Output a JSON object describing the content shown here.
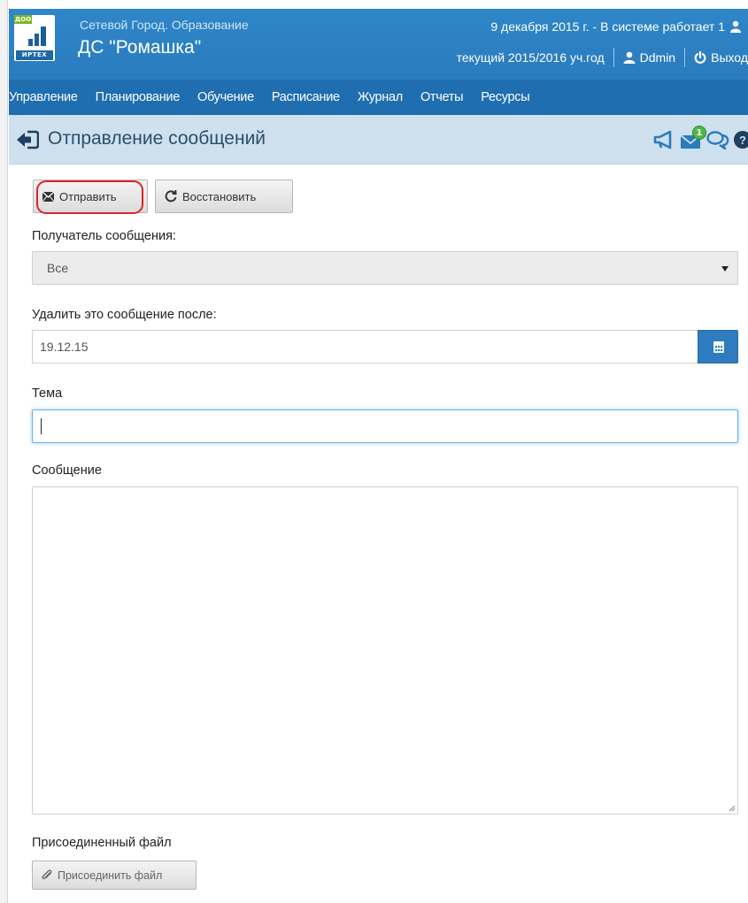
{
  "header": {
    "logo_tag": "ДОО",
    "logo_brand": "ИРТЕХ",
    "system_name": "Сетевой Город. Образование",
    "org_name": "ДС \"Ромашка\"",
    "status_text": "9 декабря 2015 г. - В системе работает 1",
    "year_text": "текущий 2015/2016 уч.год",
    "user_name": "Ddmin",
    "logout_label": "Выход"
  },
  "menu": {
    "items": [
      "Управление",
      "Планирование",
      "Обучение",
      "Расписание",
      "Журнал",
      "Отчеты",
      "Ресурсы"
    ]
  },
  "titlebar": {
    "title": "Отправление сообщений",
    "mail_badge": "1"
  },
  "form": {
    "send_label": "Отправить",
    "restore_label": "Восстановить",
    "recipient_label": "Получатель сообщения:",
    "recipient_value": "Все",
    "delete_after_label": "Удалить это сообщение после:",
    "delete_after_value": "19.12.15",
    "subject_label": "Тема",
    "subject_value": "",
    "message_label": "Сообщение",
    "message_value": "",
    "attachment_label": "Присоединенный файл",
    "attach_button_label": "Присоединить файл"
  },
  "colors": {
    "header_blue": "#2b7fc0",
    "menu_blue": "#1f6eb0",
    "titlebar_bg": "#cfe0ee",
    "highlight_red": "#d9262b",
    "badge_green": "#4eb848"
  }
}
